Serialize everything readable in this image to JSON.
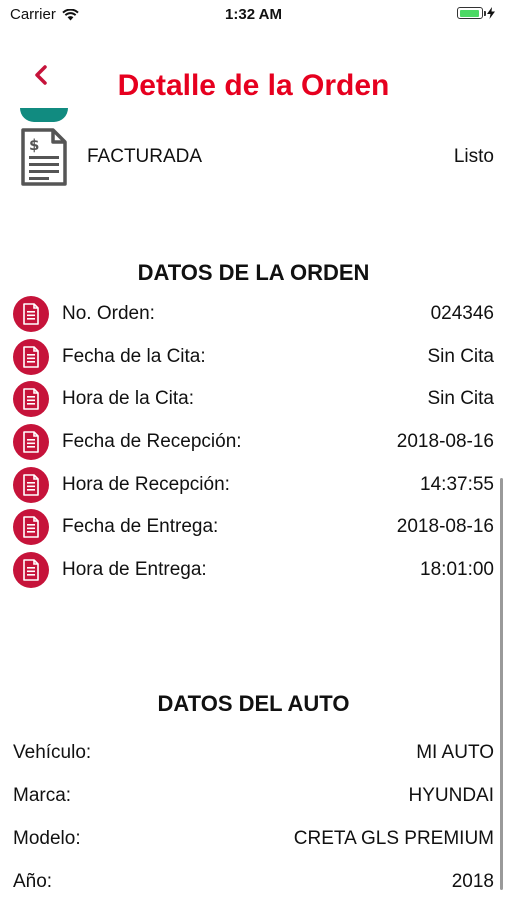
{
  "status_bar": {
    "carrier": "Carrier",
    "time": "1:32 AM",
    "battery_level": 0.85
  },
  "nav": {
    "back_icon": "chevron-left-icon",
    "title": "Detalle de la Orden",
    "accent_color": "#e6001f"
  },
  "order_status": {
    "icon": "invoice-document-icon",
    "label": "FACTURADA",
    "value": "Listo"
  },
  "order_section": {
    "title": "DATOS DE LA ORDEN",
    "icon_color": "#c6133a",
    "rows": [
      {
        "label": "No. Orden:",
        "value": "024346"
      },
      {
        "label": "Fecha de la Cita:",
        "value": "Sin Cita"
      },
      {
        "label": "Hora de la Cita:",
        "value": "Sin Cita"
      },
      {
        "label": "Fecha de Recepción:",
        "value": "2018-08-16"
      },
      {
        "label": "Hora de Recepción:",
        "value": "14:37:55"
      },
      {
        "label": "Fecha de Entrega:",
        "value": "2018-08-16"
      },
      {
        "label": "Hora de Entrega:",
        "value": "18:01:00"
      }
    ]
  },
  "car_section": {
    "title": "DATOS DEL AUTO",
    "rows": [
      {
        "label": "Vehículo:",
        "value": "MI AUTO"
      },
      {
        "label": "Marca:",
        "value": "HYUNDAI"
      },
      {
        "label": "Modelo:",
        "value": "CRETA GLS PREMIUM"
      },
      {
        "label": "Año:",
        "value": "2018"
      }
    ]
  }
}
